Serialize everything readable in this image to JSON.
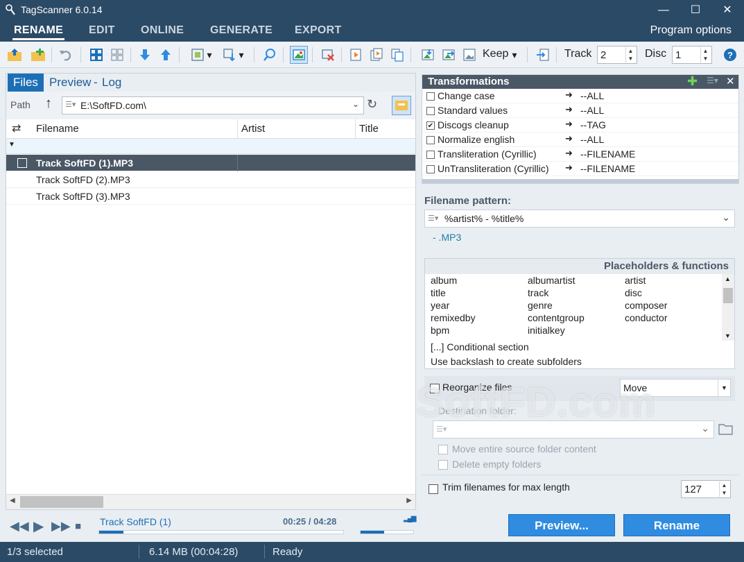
{
  "window": {
    "title": "TagScanner 6.0.14"
  },
  "tabs": {
    "rename": "RENAME",
    "edit": "EDIT",
    "online": "ONLINE",
    "generate": "GENERATE",
    "export": "EXPORT",
    "program_options": "Program options"
  },
  "toolbar": {
    "keep_label": "Keep",
    "track_label": "Track",
    "track_value": "2",
    "disc_label": "Disc",
    "disc_value": "1"
  },
  "left_panel": {
    "tabs": [
      "Files",
      "Preview",
      "-",
      "Log"
    ],
    "path_label": "Path",
    "path_value": "E:\\SoftFD.com\\",
    "columns": [
      "Filename",
      "Artist",
      "Title"
    ],
    "files": [
      "Track SoftFD (1).MP3",
      "Track SoftFD (2).MP3",
      "Track SoftFD (3).MP3"
    ]
  },
  "player": {
    "track_name": "Track SoftFD (1)",
    "time": "00:25 / 04:28",
    "progress": 0.1,
    "volume": 0.45
  },
  "transformations": {
    "title": "Transformations",
    "items": [
      {
        "name": "Change case",
        "target": "--ALL",
        "checked": false
      },
      {
        "name": "Standard values",
        "target": "--ALL",
        "checked": false
      },
      {
        "name": "Discogs cleanup",
        "target": "--TAG",
        "checked": true
      },
      {
        "name": "Normalize english",
        "target": "--ALL",
        "checked": false
      },
      {
        "name": "Transliteration (Cyrillic)",
        "target": "--FILENAME",
        "checked": false
      },
      {
        "name": "UnTransliteration (Cyrillic)",
        "target": "--FILENAME",
        "checked": false
      }
    ]
  },
  "filename_pattern": {
    "label": "Filename pattern:",
    "value": "%artist% - %title%",
    "preview": "- .MP3"
  },
  "placeholders": {
    "title": "Placeholders & functions",
    "items": [
      "album",
      "albumartist",
      "artist",
      "title",
      "track",
      "disc",
      "year",
      "genre",
      "composer",
      "remixedby",
      "contentgroup",
      "conductor",
      "bpm",
      "initialkey"
    ],
    "conditional": "[...] Conditional section",
    "hint": "Use backslash to create subfolders"
  },
  "reorganize": {
    "label": "Reorganize files",
    "mode": "Move",
    "dest_label": "Destination folder:",
    "move_entire": "Move entire source folder content",
    "delete_empty": "Delete empty folders"
  },
  "trim": {
    "label": "Trim filenames for max length",
    "value": "127"
  },
  "buttons": {
    "preview": "Preview...",
    "rename": "Rename"
  },
  "status": {
    "selected": "1/3 selected",
    "size": "6.14 MB (00:04:28)",
    "state": "Ready"
  },
  "watermark": "SoftFD.com"
}
